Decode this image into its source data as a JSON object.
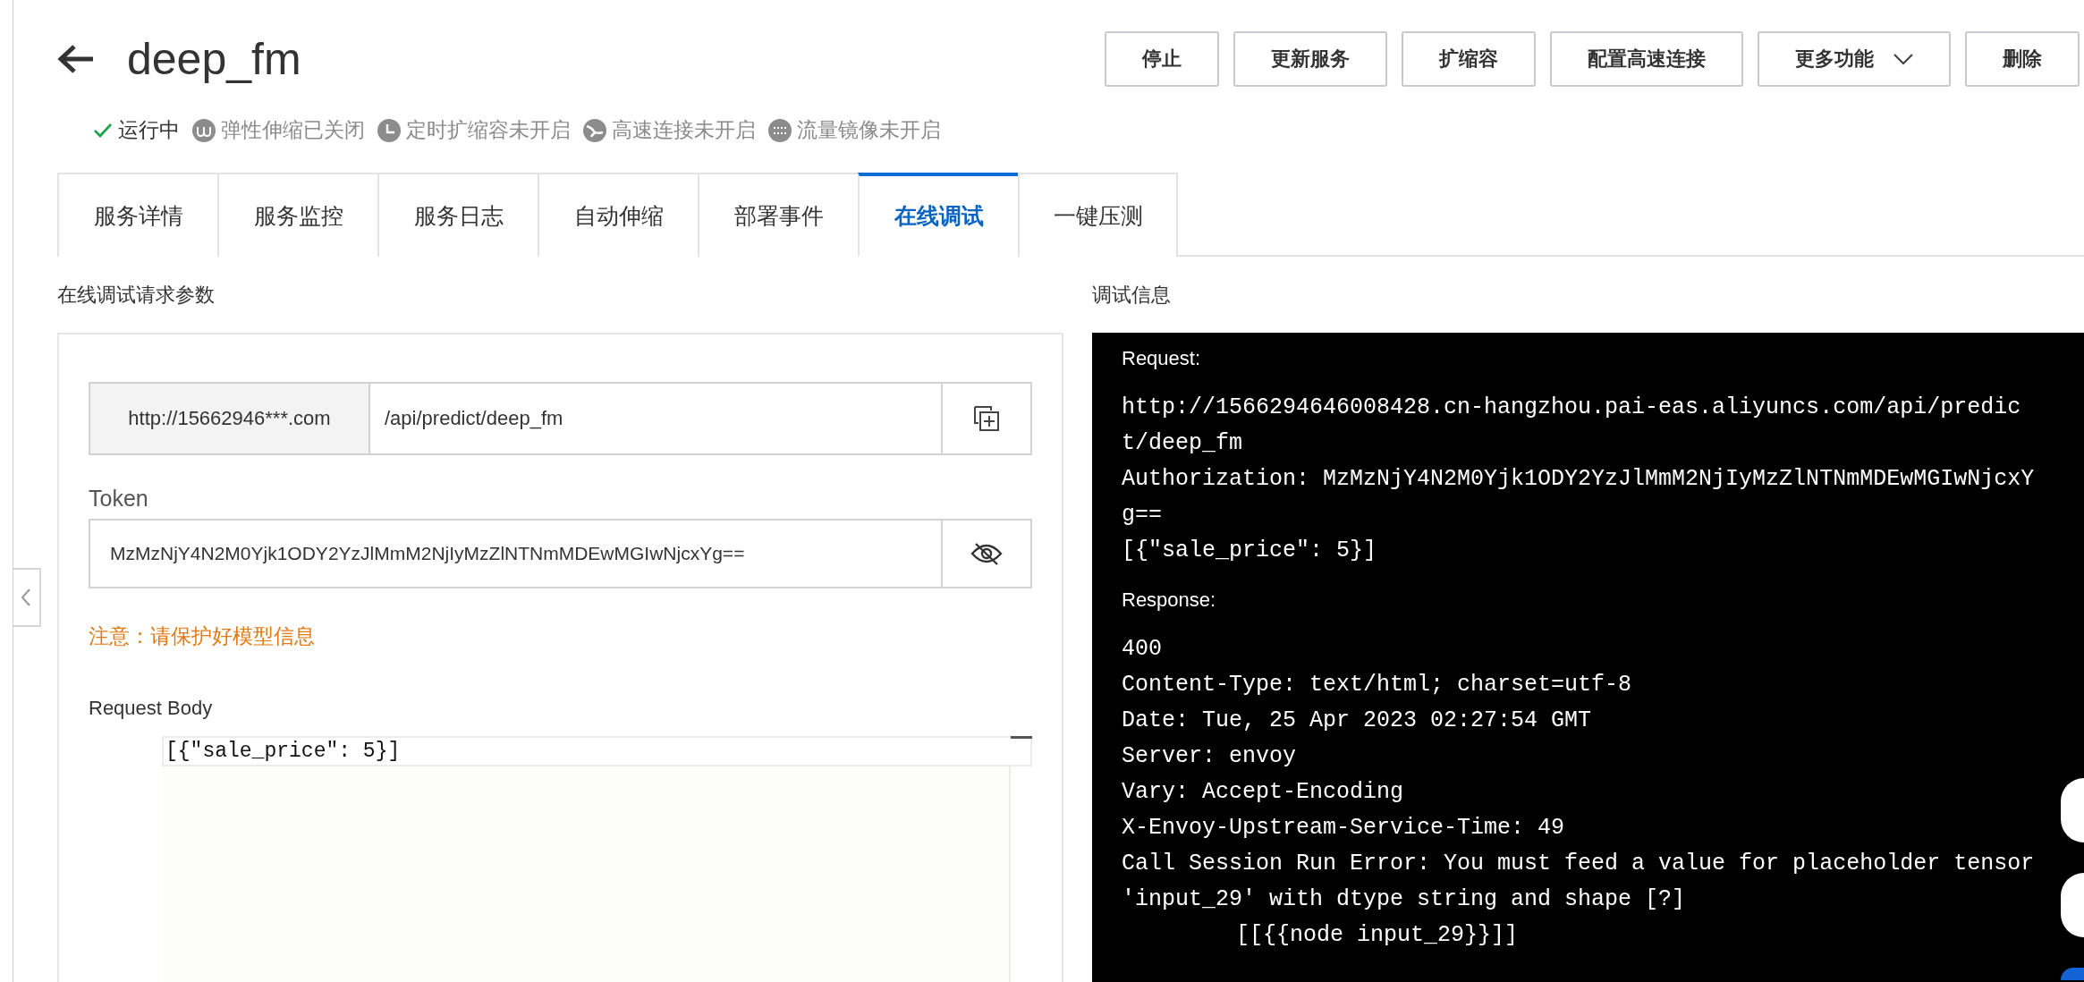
{
  "header": {
    "title": "deep_fm",
    "statuses": [
      {
        "kind": "check",
        "label": "运行中"
      },
      {
        "kind": "elastic",
        "label": "弹性伸缩已关闭"
      },
      {
        "kind": "timer",
        "label": "定时扩缩容未开启"
      },
      {
        "kind": "link",
        "label": "高速连接未开启"
      },
      {
        "kind": "mirror",
        "label": "流量镜像未开启"
      }
    ],
    "buttons": [
      {
        "label": "停止",
        "kind": "plain"
      },
      {
        "label": "更新服务",
        "kind": "plain"
      },
      {
        "label": "扩缩容",
        "kind": "plain"
      },
      {
        "label": "配置高速连接",
        "kind": "plain"
      },
      {
        "label": "更多功能",
        "kind": "dropdown"
      },
      {
        "label": "删除",
        "kind": "plain"
      }
    ]
  },
  "tabs": [
    {
      "label": "服务详情",
      "selected": false
    },
    {
      "label": "服务监控",
      "selected": false
    },
    {
      "label": "服务日志",
      "selected": false
    },
    {
      "label": "自动伸缩",
      "selected": false
    },
    {
      "label": "部署事件",
      "selected": false
    },
    {
      "label": "在线调试",
      "selected": true
    },
    {
      "label": "一键压测",
      "selected": false
    }
  ],
  "request_params": {
    "title": "在线调试请求参数",
    "url_prefix": "http://15662946***.com",
    "url_path": "/api/predict/deep_fm",
    "token_label": "Token",
    "token": "MzMzNjY4N2M0Yjk1ODY2YzJlMmM2NjIyMzZlNTNmMDEwMGIwNjcxYg==",
    "note": "注意：请保护好模型信息",
    "body_label": "Request Body",
    "body": "[{\"sale_price\": 5}]"
  },
  "debug_info": {
    "title": "调试信息",
    "request_label": "Request:",
    "request_lines": [
      {
        "text": "http://1566294646008428.cn-hangzhou.pai-eas.aliyuncs.com/api/predict/deep_fm",
        "indent": false
      },
      {
        "text": "Authorization: MzMzNjY4N2M0Yjk1ODY2YzJlMmM2NjIyMzZlNTNmMDEwMGIwNjcxYg==",
        "indent": false
      },
      {
        "text": "[{\"sale_price\": 5}]",
        "indent": false
      }
    ],
    "response_label": "Response:",
    "response_lines": [
      {
        "text": "400",
        "indent": false
      },
      {
        "text": "Content-Type: text/html; charset=utf-8",
        "indent": false
      },
      {
        "text": "Date: Tue, 25 Apr 2023 02:27:54 GMT",
        "indent": false
      },
      {
        "text": "Server: envoy",
        "indent": false
      },
      {
        "text": "Vary: Accept-Encoding",
        "indent": false
      },
      {
        "text": "X-Envoy-Upstream-Service-Time: 49",
        "indent": false
      },
      {
        "text": "Call Session Run Error: You must feed a value for placeholder tensor 'input_29' with dtype string and shape [?]",
        "indent": false
      },
      {
        "text": "[[{{node input_29}}]]",
        "indent": true
      }
    ]
  }
}
